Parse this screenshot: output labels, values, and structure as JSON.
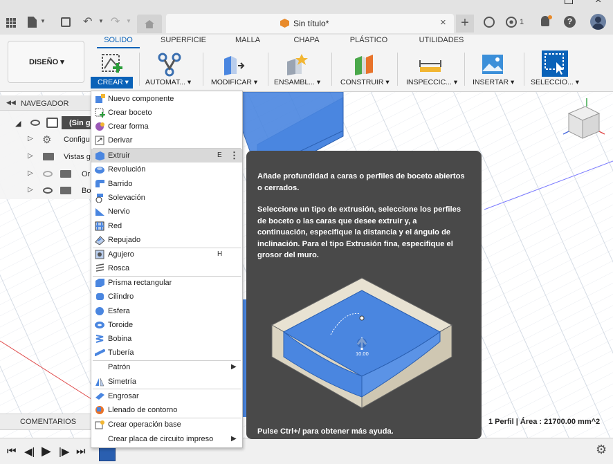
{
  "window": {
    "title": "Sin título*",
    "badge_count": "1"
  },
  "ribbon": {
    "tabs": [
      {
        "label": "SOLIDO",
        "active": true
      },
      {
        "label": "SUPERFICIE"
      },
      {
        "label": "MALLA"
      },
      {
        "label": "CHAPA"
      },
      {
        "label": "PLÁSTICO"
      },
      {
        "label": "UTILIDADES"
      }
    ],
    "workspace": "DISEÑO ▾",
    "groups": [
      {
        "label": "CREAR ▾",
        "active": true
      },
      {
        "label": "AUTOMAT... ▾"
      },
      {
        "label": "MODIFICAR ▾"
      },
      {
        "label": "ENSAMBL... ▾"
      },
      {
        "label": "CONSTRUIR ▾"
      },
      {
        "label": "INSPECCIC... ▾"
      },
      {
        "label": "INSERTAR ▾"
      },
      {
        "label": "SELECCIO... ▾"
      }
    ]
  },
  "navigator": {
    "title": "NAVEGADOR",
    "items": [
      {
        "label": "(Sin g"
      },
      {
        "label": "Configu"
      },
      {
        "label": "Vistas g"
      },
      {
        "label": "Or"
      },
      {
        "label": "Bo"
      }
    ]
  },
  "comments": {
    "label": "COMENTARIOS"
  },
  "status": {
    "text": "1 Perfil | Área : 21700.00 mm^2"
  },
  "menu": {
    "items": [
      {
        "label": "Nuevo componente",
        "icon": "new-component-icon"
      },
      {
        "label": "Crear boceto",
        "icon": "sketch-icon"
      },
      {
        "label": "Crear forma",
        "icon": "form-icon"
      },
      {
        "label": "Derivar",
        "icon": "derive-icon"
      },
      {
        "label": "Extruir",
        "icon": "extrude-icon",
        "shortcut": "E",
        "highlighted": true
      },
      {
        "label": "Revolución",
        "icon": "revolve-icon"
      },
      {
        "label": "Barrido",
        "icon": "sweep-icon"
      },
      {
        "label": "Solevación",
        "icon": "loft-icon"
      },
      {
        "label": "Nervio",
        "icon": "rib-icon"
      },
      {
        "label": "Red",
        "icon": "web-icon"
      },
      {
        "label": "Repujado",
        "icon": "emboss-icon"
      },
      {
        "label": "Agujero",
        "icon": "hole-icon",
        "shortcut": "H"
      },
      {
        "label": "Rosca",
        "icon": "thread-icon"
      },
      {
        "label": "Prisma rectangular",
        "icon": "box-icon"
      },
      {
        "label": "Cilindro",
        "icon": "cylinder-icon"
      },
      {
        "label": "Esfera",
        "icon": "sphere-icon"
      },
      {
        "label": "Toroide",
        "icon": "torus-icon"
      },
      {
        "label": "Bobina",
        "icon": "coil-icon"
      },
      {
        "label": "Tubería",
        "icon": "pipe-icon"
      },
      {
        "label": "Patrón",
        "submenu": true
      },
      {
        "label": "Simetría",
        "icon": "mirror-icon"
      },
      {
        "label": "Engrosar",
        "icon": "thicken-icon"
      },
      {
        "label": "Llenado de contorno",
        "icon": "boundary-fill-icon"
      },
      {
        "label": "Crear operación base",
        "icon": "base-feature-icon"
      },
      {
        "label": "Crear placa de circuito impreso",
        "submenu": true
      }
    ]
  },
  "tooltip": {
    "title": "Añade profundidad a caras o perfiles de boceto abiertos o cerrados.",
    "body": "Seleccione un tipo de extrusión, seleccione los perfiles de boceto o las caras que desee extruir y, a continuación, especifique la distancia y el ángulo de inclinación. Para el tipo Extrusión fina, especifique el grosor del muro.",
    "dimension": "10.00",
    "footer": "Pulse Ctrl+/ para obtener más ayuda."
  },
  "colors": {
    "accent": "#0a62b8",
    "highlight": "#d9d9d9",
    "tooltip_bg": "#494949",
    "face_blue": "#4a86e0"
  }
}
